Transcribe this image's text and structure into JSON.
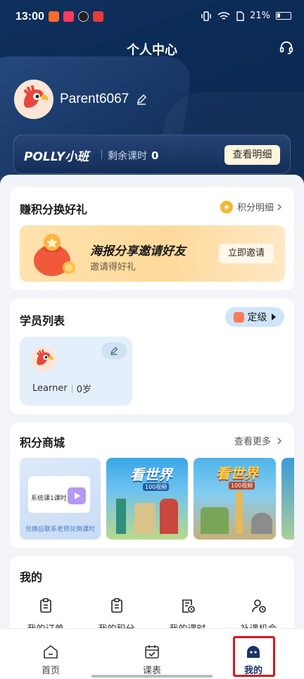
{
  "status_bar": {
    "time": "13:00",
    "battery": "21%"
  },
  "header": {
    "title": "个人中心"
  },
  "profile": {
    "username": "Parent6067"
  },
  "class_card": {
    "brand": "POLLY小班",
    "remain_label": "剩余课时",
    "remain_value": "0",
    "detail_button": "查看明细"
  },
  "points_section": {
    "title": "赚积分换好礼",
    "link_label": "积分明细",
    "banner": {
      "headline": "海报分享邀请好友",
      "subtext": "邀请得好礼",
      "button": "立即邀请"
    }
  },
  "students_section": {
    "title": "学员列表",
    "level_button": "定级",
    "students": [
      {
        "name": "Learner",
        "age": "0岁"
      }
    ]
  },
  "mall_section": {
    "title": "积分商城",
    "more_label": "查看更多",
    "items": [
      {
        "title": "系统课1课时",
        "caption": "兑换后联系老师兑换课时"
      },
      {
        "title": "看世界",
        "subtitle": "100视频"
      },
      {
        "title": "看世界",
        "subtitle": "100视频"
      }
    ]
  },
  "mine_section": {
    "title": "我的",
    "items": [
      {
        "label": "我的订单",
        "icon": "order-icon"
      },
      {
        "label": "我的积分",
        "icon": "points-icon"
      },
      {
        "label": "我的课时",
        "icon": "lesson-hours-icon"
      },
      {
        "label": "补课机会",
        "icon": "makeup-icon"
      }
    ]
  },
  "tabbar": {
    "tabs": [
      {
        "label": "首页",
        "icon": "home-icon"
      },
      {
        "label": "课表",
        "icon": "calendar-icon"
      },
      {
        "label": "我的",
        "icon": "profile-icon"
      }
    ],
    "active": "我的"
  },
  "colors": {
    "header_bg": "#0b2a55",
    "accent_active": "#1a3468",
    "highlight_box": "#e0141e"
  }
}
